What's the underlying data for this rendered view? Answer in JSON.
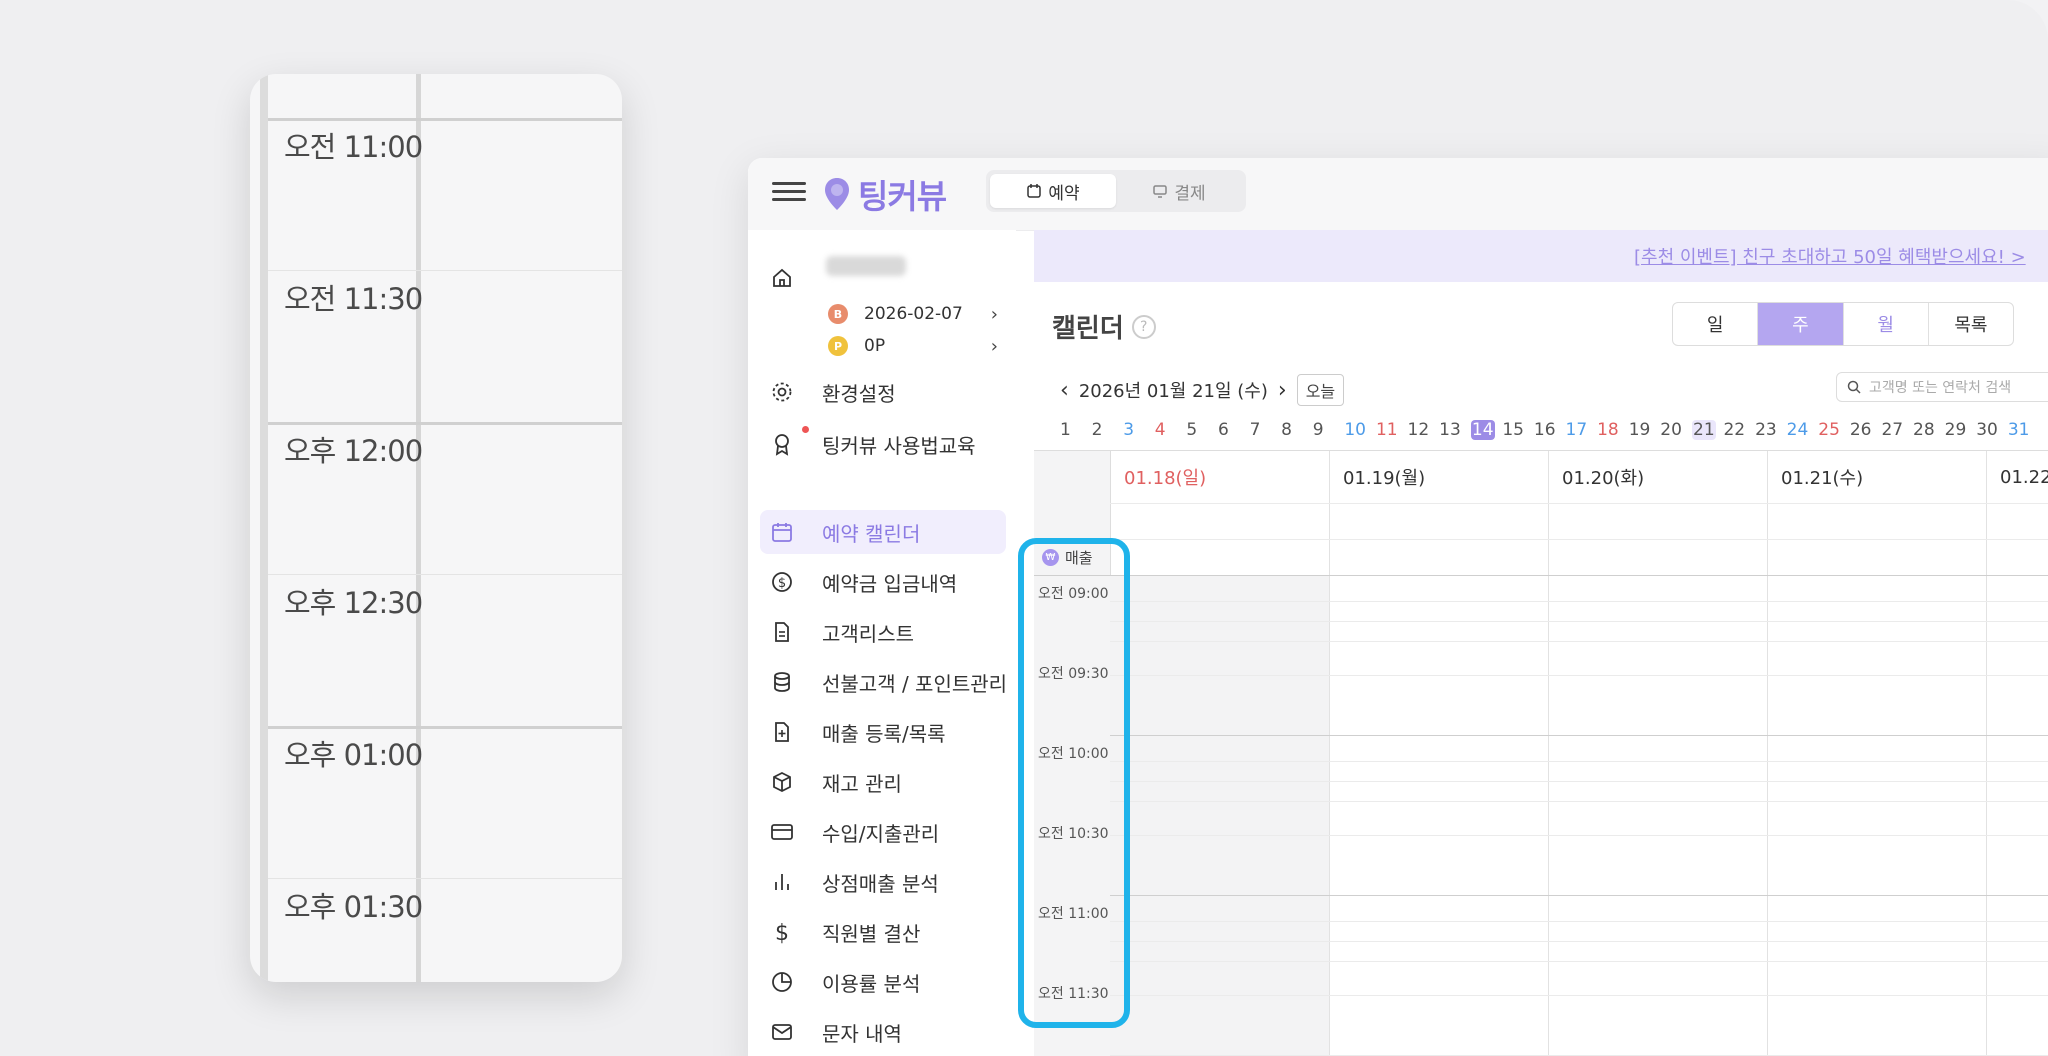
{
  "zoom": {
    "slots": [
      "오전 11:00",
      "오전 11:30",
      "오후 12:00",
      "오후 12:30",
      "오후 01:00",
      "오후 01:30"
    ]
  },
  "app": {
    "brand": "팅커뷰",
    "tabs": [
      {
        "label": "예약",
        "active": true
      },
      {
        "label": "결제",
        "active": false
      }
    ],
    "sidebar": {
      "shop_name": "",
      "expiry": "2026-02-07",
      "points": "0P",
      "items": [
        {
          "label": "환경설정",
          "icon": "gear-icon"
        },
        {
          "label": "팅커뷰 사용법교육",
          "icon": "badge-icon"
        },
        {
          "label": "예약 캘린더",
          "icon": "calendar-icon",
          "active": true
        },
        {
          "label": "예약금 입금내역",
          "icon": "dollar-circle-icon"
        },
        {
          "label": "고객리스트",
          "icon": "document-icon"
        },
        {
          "label": "선불고객 / 포인트관리",
          "icon": "database-icon"
        },
        {
          "label": "매출 등록/목록",
          "icon": "file-plus-icon"
        },
        {
          "label": "재고 관리",
          "icon": "box-icon"
        },
        {
          "label": "수입/지출관리",
          "icon": "card-icon"
        },
        {
          "label": "상점매출 분석",
          "icon": "bar-chart-icon"
        },
        {
          "label": "직원별 결산",
          "icon": "dollar-icon"
        },
        {
          "label": "이용률 분석",
          "icon": "pie-chart-icon"
        },
        {
          "label": "문자 내역",
          "icon": "mail-icon"
        }
      ]
    },
    "banner": "[추천 이벤트] 친구 초대하고 50일 혜택받으세요! >",
    "calendar": {
      "title": "캘린더",
      "help": "?",
      "views": [
        "일",
        "주",
        "월",
        "목록"
      ],
      "active_view": "주",
      "current_date": "2026년 01월 21일 (수)",
      "today": "오늘",
      "search_placeholder": "고객명 또는 연락처 검색",
      "day_numbers": [
        "1",
        "2",
        "3",
        "4",
        "5",
        "6",
        "7",
        "8",
        "9",
        "10",
        "11",
        "12",
        "13",
        "14",
        "15",
        "16",
        "17",
        "18",
        "19",
        "20",
        "21",
        "22",
        "23",
        "24",
        "25",
        "26",
        "27",
        "28",
        "29",
        "30",
        "31"
      ],
      "columns": [
        "01.18(일)",
        "01.19(월)",
        "01.20(화)",
        "01.21(수)",
        "01.22"
      ],
      "sales_label": "매출",
      "times": [
        "오전 09:00",
        "오전 09:30",
        "오전 10:00",
        "오전 10:30",
        "오전 11:00",
        "오전 11:30"
      ]
    }
  },
  "colors": {
    "accent": "#8b7ae3",
    "highlight": "#1fb3ea",
    "sunday": "#e06060",
    "saturday": "#4d9be8"
  }
}
